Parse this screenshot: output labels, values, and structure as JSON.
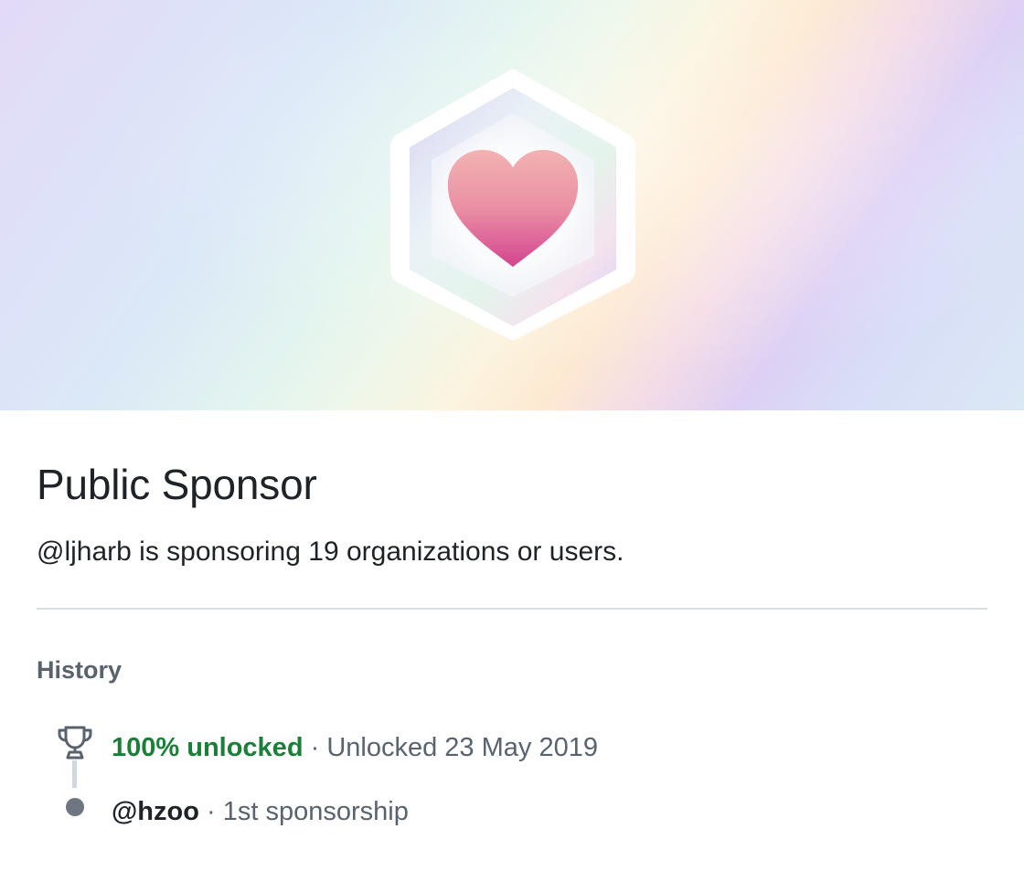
{
  "badge": {
    "icon": "heart-icon",
    "colors": {
      "heart_top": "#f2a9b0",
      "heart_bottom": "#d94e93",
      "hexagon_border": "#ffffff"
    }
  },
  "achievement": {
    "title": "Public Sponsor",
    "description": "@ljharb is sponsoring 19 organizations or users."
  },
  "history": {
    "heading": "History",
    "entries": [
      {
        "icon": "trophy-icon",
        "status": "100% unlocked",
        "separator": "·",
        "detail": "Unlocked 23 May 2019",
        "status_color": "#1a7f37"
      },
      {
        "icon": "dot-icon",
        "user": "@hzoo",
        "separator": "·",
        "detail": "1st sponsorship"
      }
    ]
  }
}
